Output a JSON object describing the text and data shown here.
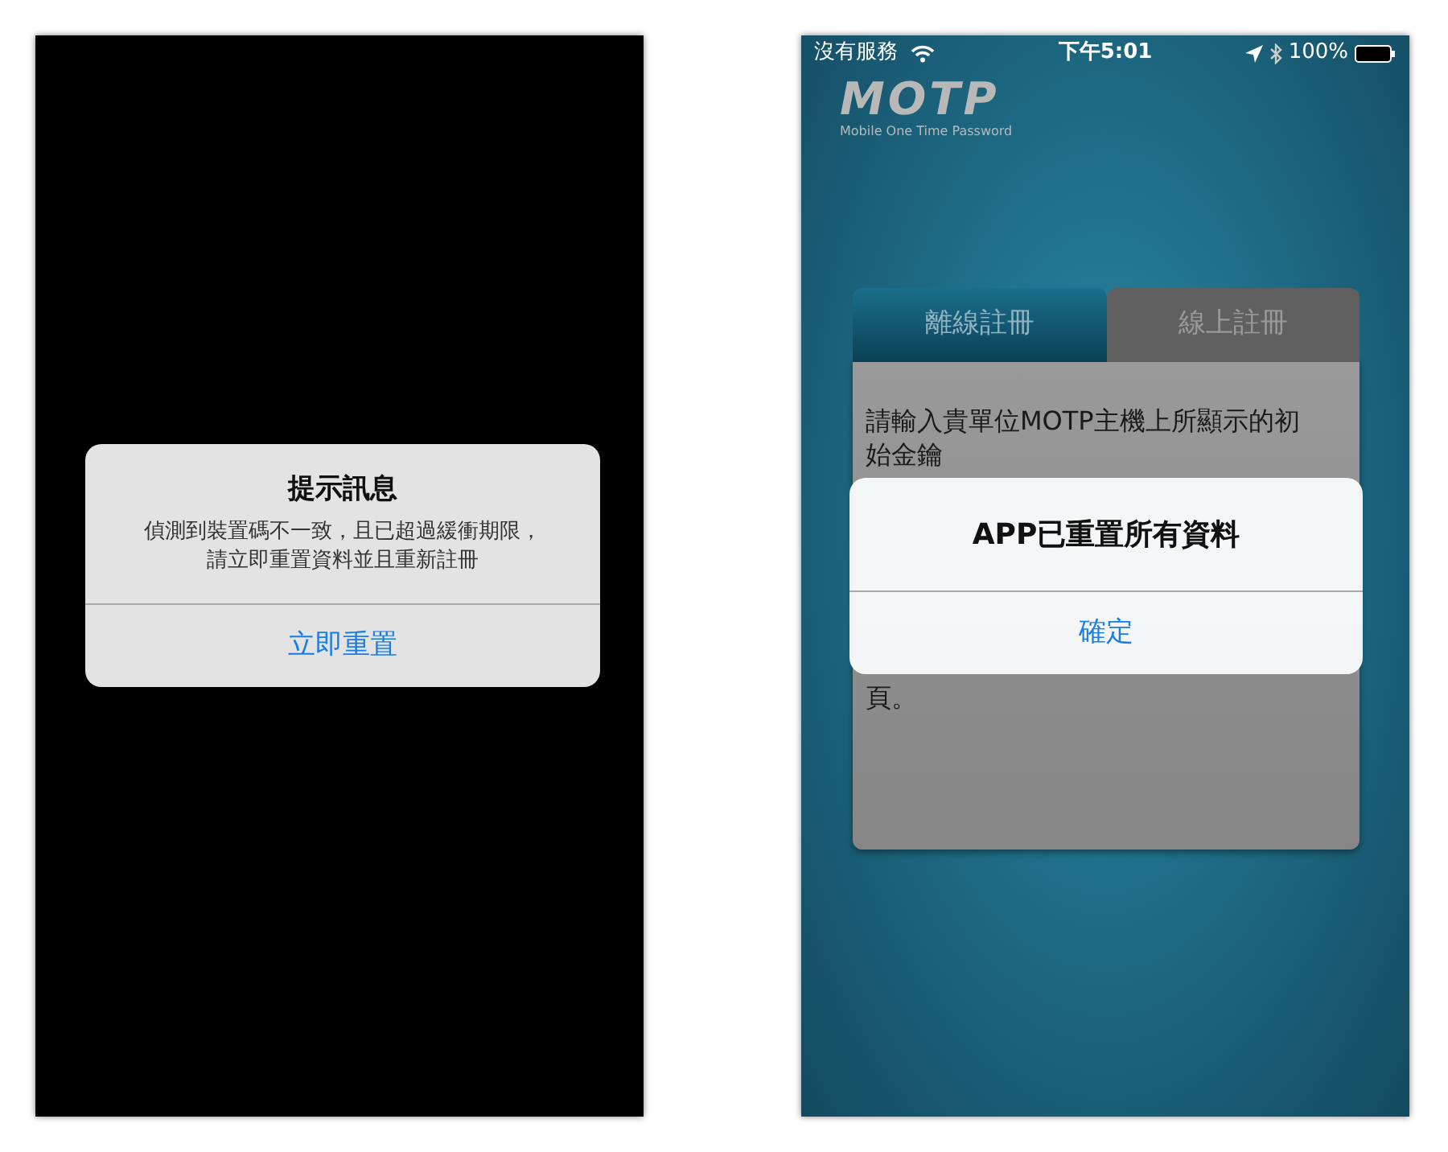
{
  "left_screen": {
    "alert": {
      "title": "提示訊息",
      "message": "偵測到裝置碼不一致，且已超過緩衝期限，請立即重置資料並且重新註冊",
      "button": "立即重置"
    }
  },
  "right_screen": {
    "status_bar": {
      "carrier": "沒有服務",
      "time": "下午5:01",
      "battery": "100%"
    },
    "logo": {
      "text": "MOTP",
      "subtitle": "Mobile One Time Password"
    },
    "tabs": [
      {
        "label": "離線註冊",
        "selected": true
      },
      {
        "label": "線上註冊",
        "selected": false
      }
    ],
    "panel": {
      "instruction": "請輸入貴單位MOTP主機上所顯示的初始金鑰",
      "note": "頁。"
    },
    "alert": {
      "title": "APP已重置所有資料",
      "button": "確定"
    }
  }
}
